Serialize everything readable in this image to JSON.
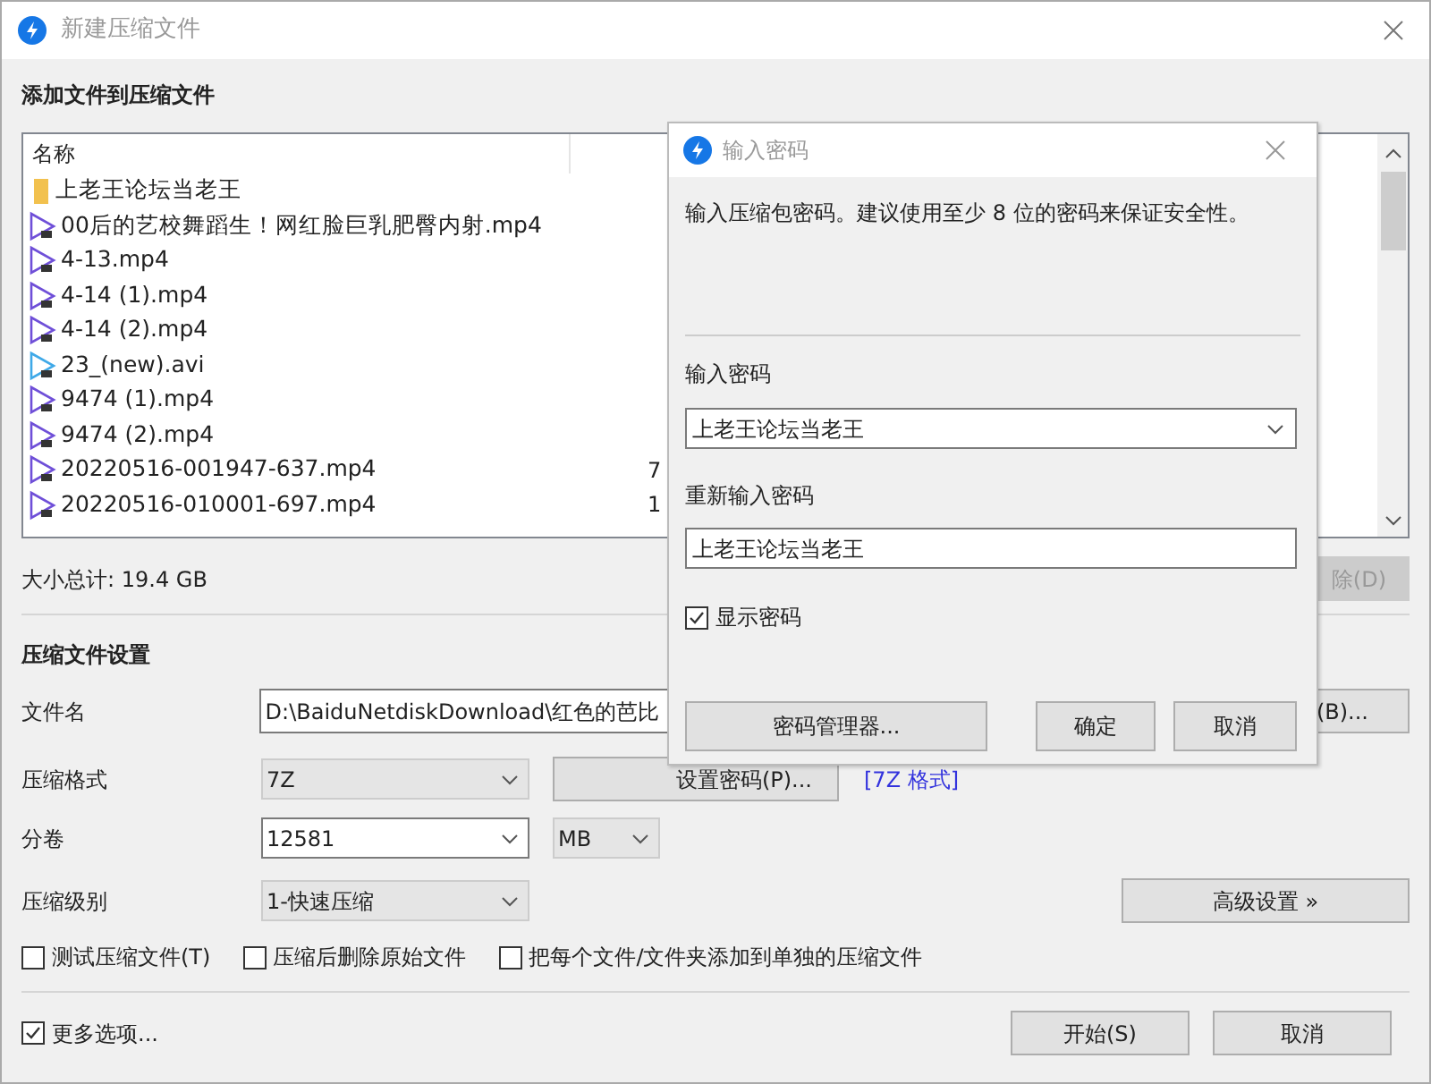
{
  "window": {
    "title": "新建压缩文件"
  },
  "files": {
    "title": "添加文件到压缩文件",
    "columns": [
      "名称"
    ],
    "rows": [
      {
        "kind": "folder",
        "name": "上老王论坛当老王"
      },
      {
        "kind": "video",
        "color": "#6f4fd8",
        "name": "00后的艺校舞蹈生！网红脸巨乳肥臀内射.mp4"
      },
      {
        "kind": "video",
        "color": "#6f4fd8",
        "name": "4-13.mp4"
      },
      {
        "kind": "video",
        "color": "#6f4fd8",
        "name": "4-14 (1).mp4"
      },
      {
        "kind": "video",
        "color": "#6f4fd8",
        "name": "4-14 (2).mp4"
      },
      {
        "kind": "video",
        "color": "#3fa9e8",
        "name": "23_(new).avi"
      },
      {
        "kind": "video",
        "color": "#6f4fd8",
        "name": "9474 (1).mp4"
      },
      {
        "kind": "video",
        "color": "#6f4fd8",
        "name": "9474 (2).mp4"
      },
      {
        "kind": "video",
        "color": "#6f4fd8",
        "name": "20220516-001947-637.mp4",
        "column_2": "7"
      },
      {
        "kind": "video",
        "color": "#6f4fd8",
        "name": "20220516-010001-697.mp4",
        "column_2": "1"
      }
    ],
    "total": "大小总计: 19.4 GB",
    "delete_button": "除(D)"
  },
  "settings": {
    "title": "压缩文件设置",
    "filename": {
      "label": "文件名",
      "value": "D:\\BaiduNetdiskDownload\\红色的芭比",
      "browse_button": "(B)..."
    },
    "format": {
      "label": "压缩格式",
      "value": "7Z",
      "password_button": "设置密码(P)...",
      "link": "[7Z 格式]"
    },
    "volume": {
      "label": "分卷",
      "value": "12581",
      "unit": "MB"
    },
    "level": {
      "label": "压缩级别",
      "value": "1-快速压缩",
      "advanced_button": "高级设置 »"
    },
    "options": [
      {
        "label": "测试压缩文件(T)",
        "checked": false
      },
      {
        "label": "压缩后删除原始文件",
        "checked": false
      },
      {
        "label": "把每个文件/文件夹添加到单独的压缩文件",
        "checked": false
      }
    ]
  },
  "more_options": {
    "label": "更多选项...",
    "checked": true
  },
  "buttons": [
    "开始(S)",
    "取消"
  ],
  "dialog": {
    "title": "输入密码",
    "message": "输入压缩包密码。建议使用至少 8 位的密码来保证安全性。",
    "password_label": "输入密码",
    "password": "上老王论坛当老王",
    "repeat_label": "重新输入密码",
    "repeat": "上老王论坛当老王",
    "show_password": {
      "label": "显示密码",
      "checked": true
    },
    "buttons": [
      "密码管理器...",
      "确定",
      "取消"
    ]
  }
}
